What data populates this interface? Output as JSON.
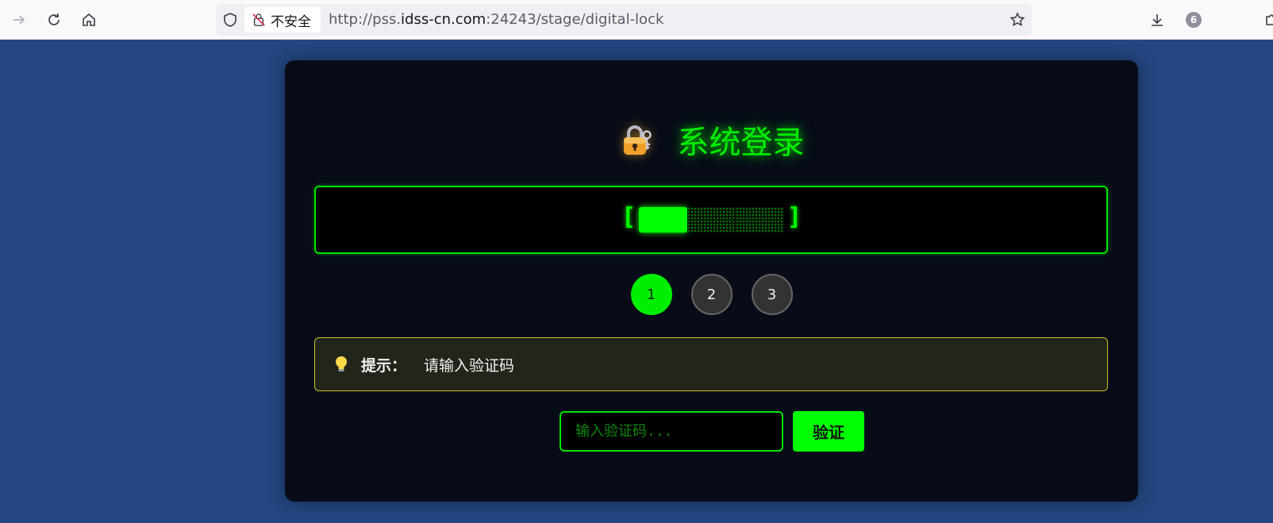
{
  "browser": {
    "security_label": "不安全",
    "url_prefix": "http://pss.",
    "url_domain": "idss-cn.com",
    "url_suffix": ":24243/stage/digital-lock",
    "downloads_badge": "6",
    "icons": [
      "back-icon",
      "reload-icon",
      "home-icon",
      "shield-icon",
      "insecure-lock-icon",
      "bookmark-star-icon",
      "download-icon",
      "extensions-icon"
    ]
  },
  "panel": {
    "title": "系统登录",
    "title_icon": "padlock-key-icon",
    "display": {
      "bracket_left": "[",
      "bracket_right": "]",
      "total_digits": 3,
      "filled_digits": 1
    },
    "steps": [
      {
        "label": "1",
        "state": "active"
      },
      {
        "label": "2",
        "state": "idle"
      },
      {
        "label": "3",
        "state": "idle"
      }
    ],
    "hint": {
      "icon": "lightbulb-icon",
      "label": "提示：",
      "text": "请输入验证码"
    },
    "input": {
      "placeholder": "输入验证码...",
      "value": ""
    },
    "verify_label": "验证"
  },
  "colors": {
    "page_bg": "#244782",
    "panel_bg": "#070c18",
    "accent_green": "#00ff00",
    "hint_border": "#c9c127"
  }
}
